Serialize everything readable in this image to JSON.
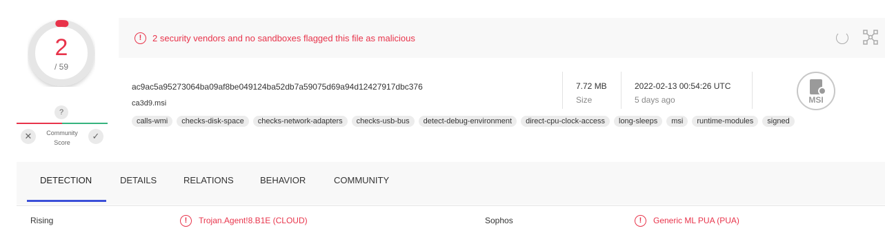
{
  "score": {
    "detections": "2",
    "total": "/ 59",
    "color": "#e8334a",
    "fraction": 0.034
  },
  "community": {
    "badge": "?",
    "label_line1": "Community",
    "label_line2": "Score",
    "down_symbol": "✕",
    "up_symbol": "✓"
  },
  "alert": {
    "text": "2 security vendors and no sandboxes flagged this file as malicious",
    "icon": "!",
    "color": "#e8334a"
  },
  "file": {
    "hash": "ac9ac5a95273064ba09af8be049124ba52db7a59075d69a94d12427917dbc376",
    "name": "ca3d9.msi",
    "size_value": "7.72 MB",
    "size_label": "Size",
    "date_value": "2022-02-13 00:54:26 UTC",
    "date_label": "5 days ago",
    "type_icon_label": "MSI"
  },
  "tags": [
    "calls-wmi",
    "checks-disk-space",
    "checks-network-adapters",
    "checks-usb-bus",
    "detect-debug-environment",
    "direct-cpu-clock-access",
    "long-sleeps",
    "msi",
    "runtime-modules",
    "signed"
  ],
  "tabs": [
    "DETECTION",
    "DETAILS",
    "RELATIONS",
    "BEHAVIOR",
    "COMMUNITY"
  ],
  "results": [
    {
      "vendor": "Rising",
      "result": "Trojan.Agent!8.B1E (CLOUD)",
      "icon": "!"
    },
    {
      "vendor": "Sophos",
      "result": "Generic ML PUA (PUA)",
      "icon": "!"
    }
  ],
  "colors": {
    "accent_tab": "#3b4fd8",
    "malicious": "#e8334a",
    "harmless": "#36b37e"
  }
}
